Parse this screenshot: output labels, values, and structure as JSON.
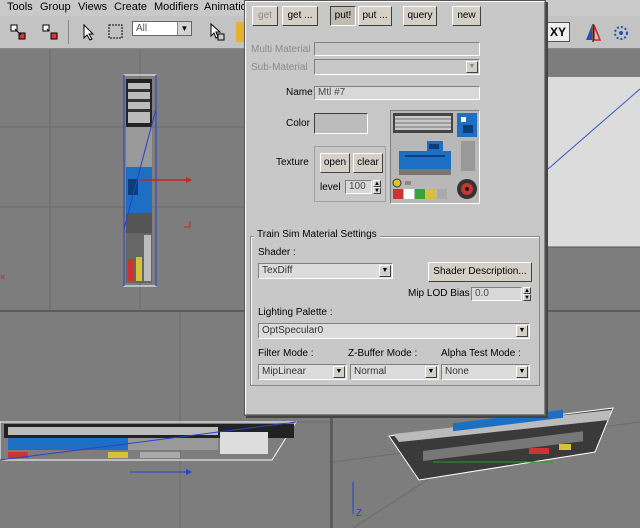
{
  "menubar": {
    "items": [
      "Tools",
      "Group",
      "Views",
      "Create",
      "Modifiers",
      "Animation"
    ]
  },
  "toolbar": {
    "selection_filter": "All",
    "xy_label": "XY"
  },
  "dialog": {
    "buttons": {
      "get_disabled": "get",
      "get_more": "get ...",
      "put": "put!",
      "put_more": "put ...",
      "query": "query",
      "new": "new"
    },
    "multi_material_label": "Multi Material",
    "sub_material_label": "Sub-Material",
    "name_label": "Name",
    "name_value": "Mtl #7",
    "color_label": "Color",
    "texture_label": "Texture",
    "open_label": "open",
    "clear_label": "clear",
    "level_label": "level",
    "level_value": "100",
    "settings": {
      "title": "Train Sim Material Settings",
      "shader_label": "Shader :",
      "shader_value": "TexDiff",
      "shader_desc_button": "Shader Description...",
      "mip_lod_label": "Mip LOD Bias",
      "mip_lod_value": "0.0",
      "lighting_label": "Lighting Palette :",
      "lighting_value": "OptSpecular0",
      "filter_label": "Filter Mode :",
      "filter_value": "MipLinear",
      "zbuffer_label": "Z-Buffer Mode :",
      "zbuffer_value": "Normal",
      "alpha_label": "Alpha Test Mode :",
      "alpha_value": "None"
    }
  },
  "viewport": {
    "axis_label": "Z"
  },
  "colors": {
    "dialog_bg": "#c8c8c8",
    "viewport_bg": "#7d7d7d",
    "locomotive_blue": "#1d6fc4"
  }
}
